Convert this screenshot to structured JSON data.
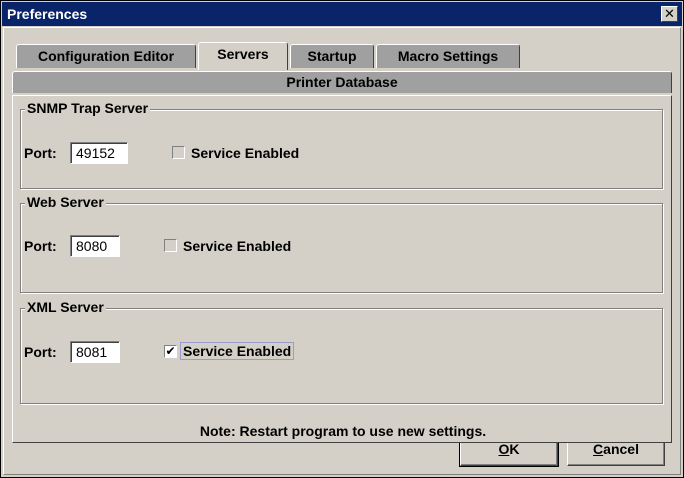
{
  "window": {
    "title": "Preferences",
    "close_glyph": "✕"
  },
  "tabs": {
    "row1": [
      "Configuration Editor",
      "Servers",
      "Startup",
      "Macro Settings"
    ],
    "row2": [
      "Printer Database"
    ],
    "selected": "Servers"
  },
  "servers": [
    {
      "legend": "SNMP Trap Server",
      "port_label": "Port:",
      "port": "49152",
      "check_label": "Service Enabled",
      "enabled": false
    },
    {
      "legend": "Web Server",
      "port_label": "Port:",
      "port": "8080",
      "check_label": "Service Enabled",
      "enabled": false
    },
    {
      "legend": "XML Server",
      "port_label": "Port:",
      "port": "8081",
      "check_label": "Service Enabled",
      "enabled": true,
      "check_glyph": "✔"
    }
  ],
  "note": "Note: Restart program to use new settings.",
  "buttons": {
    "ok": {
      "mnemonic": "O",
      "rest": "K"
    },
    "cancel": {
      "mnemonic": "C",
      "rest": "ancel"
    }
  }
}
